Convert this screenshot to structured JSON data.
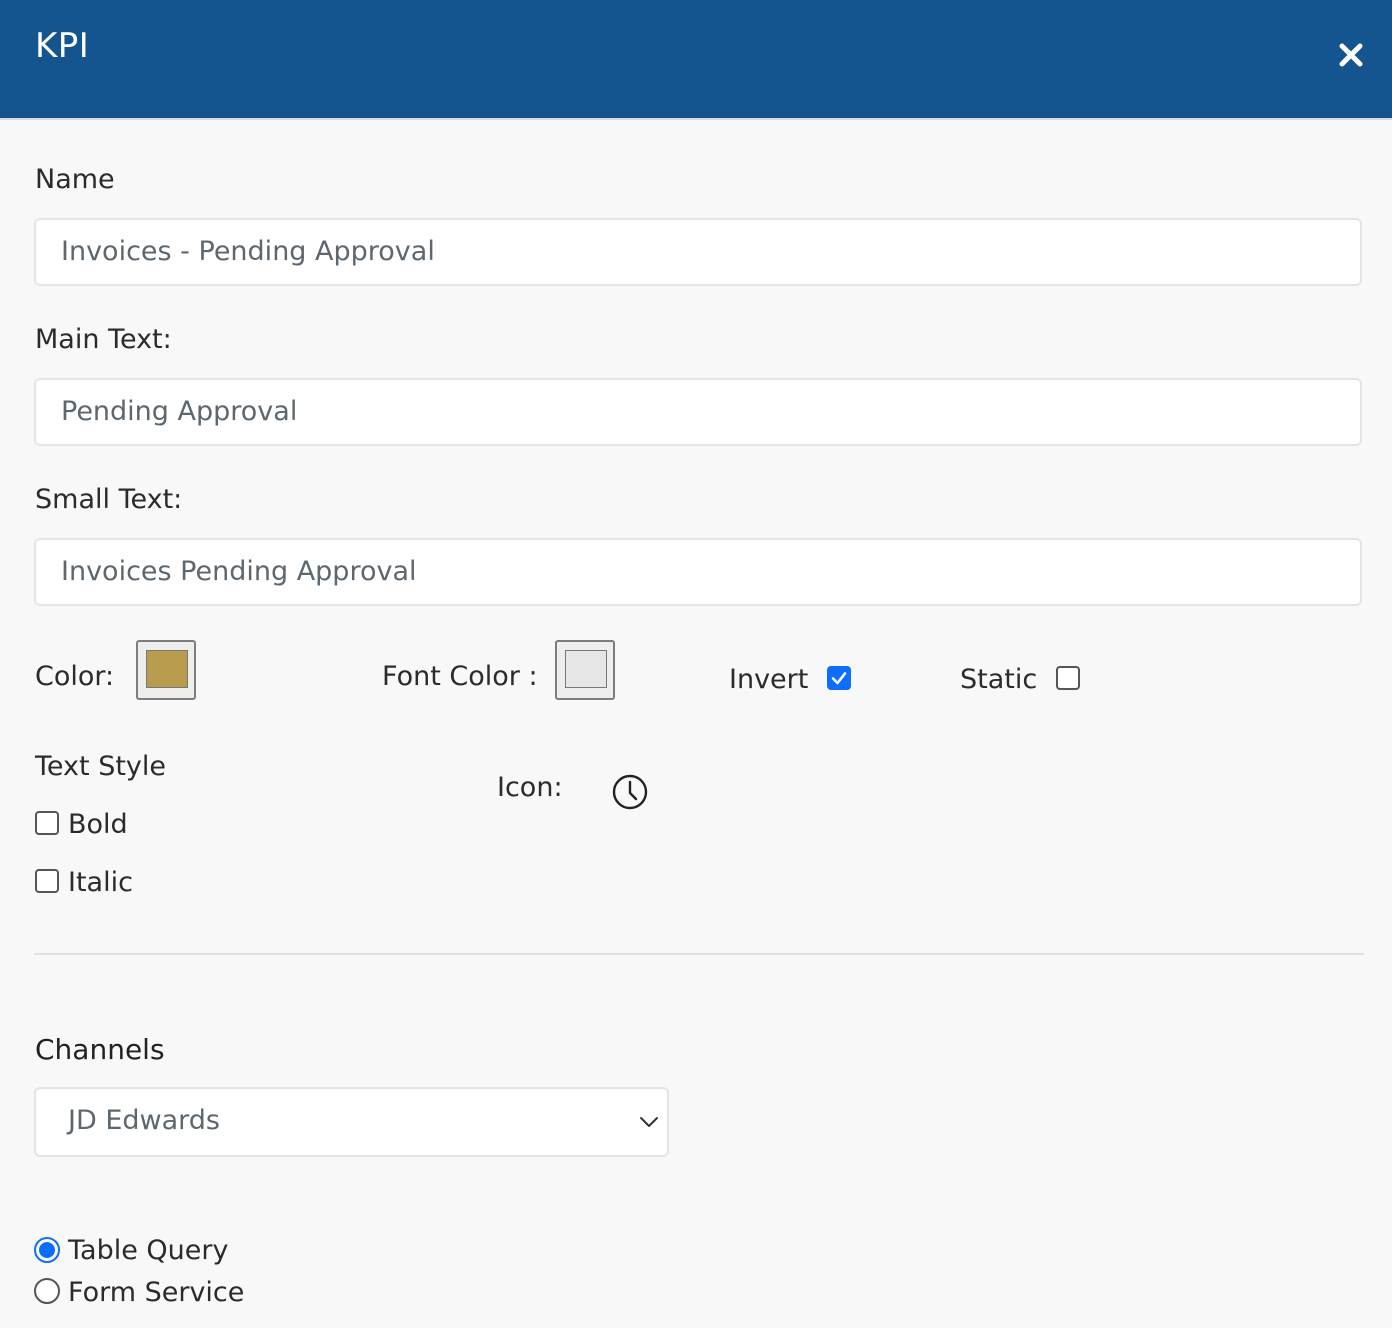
{
  "modal": {
    "title": "KPI",
    "close_icon": "close-icon"
  },
  "form": {
    "name": {
      "label": "Name",
      "value": "Invoices - Pending Approval"
    },
    "main_text": {
      "label": "Main Text:",
      "value": "Pending Approval"
    },
    "small_text": {
      "label": "Small Text:",
      "value": "Invoices Pending Approval"
    },
    "color": {
      "label": "Color:",
      "value": "#b89c4e"
    },
    "font_color": {
      "label": "Font Color :",
      "value": "#e6e6e6"
    },
    "invert": {
      "label": "Invert",
      "checked": true
    },
    "static": {
      "label": "Static",
      "checked": false
    },
    "text_style": {
      "label": "Text Style",
      "bold": {
        "label": "Bold",
        "checked": false
      },
      "italic": {
        "label": "Italic",
        "checked": false
      }
    },
    "icon": {
      "label": "Icon:",
      "name": "clock-icon"
    }
  },
  "channels": {
    "heading": "Channels",
    "selected": "JD Edwards",
    "options": [
      {
        "label": "Table Query",
        "checked": true
      },
      {
        "label": "Form Service",
        "checked": false
      }
    ]
  },
  "colors": {
    "header_bg": "#14558f",
    "accent": "#0d6efd"
  }
}
